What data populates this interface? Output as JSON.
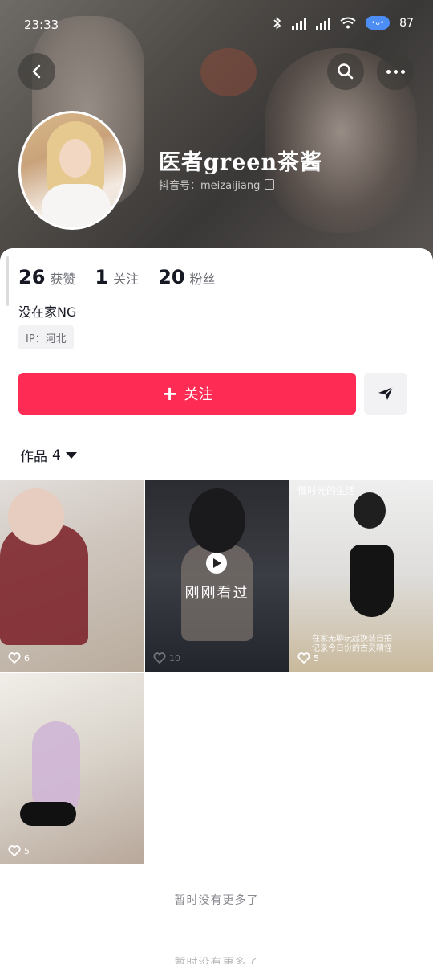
{
  "status_bar": {
    "time": "23:33",
    "battery": "87"
  },
  "profile": {
    "nickname": "医者green茶酱",
    "douyin_id": "抖音号：meizaijiang",
    "bio": "没在家NG",
    "ip": "IP：河北"
  },
  "stats": [
    {
      "value": "26",
      "label": "获赞"
    },
    {
      "value": "1",
      "label": "关注"
    },
    {
      "value": "20",
      "label": "粉丝"
    }
  ],
  "actions": {
    "follow_label": "关注",
    "follow_icon": "plus"
  },
  "works_tab": {
    "label": "作品",
    "count": "4"
  },
  "videos": [
    {
      "likes": "6"
    },
    {
      "likes": "10",
      "overlay_label": "刚刚看过"
    },
    {
      "likes": "5",
      "caption_top": "慢时光的生活",
      "caption_bottom": "在家无聊玩起换装自拍\n记录今日份的古灵精怪"
    },
    {
      "likes": "5"
    }
  ],
  "footer": {
    "no_more": "暂时没有更多了",
    "bottom_peek": "暂时没有更多了"
  },
  "icons": [
    "back-icon",
    "search-icon",
    "more-icon",
    "share-icon",
    "copy-icon",
    "heart-icon",
    "play-icon"
  ],
  "colors": {
    "accent": "#fe2c55",
    "ip_bg": "#f2f2f4"
  }
}
